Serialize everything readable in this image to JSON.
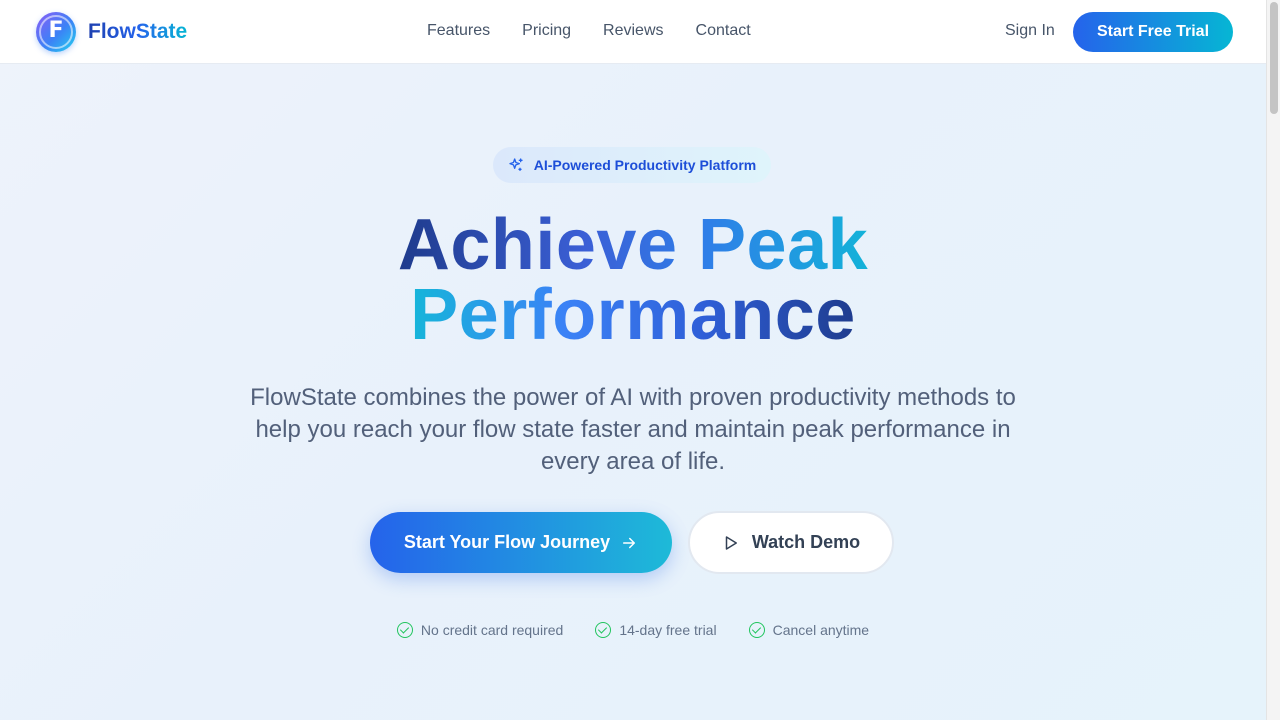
{
  "header": {
    "brand": "FlowState",
    "logo_letter": "F",
    "nav": [
      "Features",
      "Pricing",
      "Reviews",
      "Contact"
    ],
    "sign_in": "Sign In",
    "cta": "Start Free Trial"
  },
  "hero": {
    "badge_icon": "sparkles-icon",
    "badge": "AI-Powered Productivity Platform",
    "headline_line1": "Achieve Peak",
    "headline_line2": "Performance",
    "subtitle": "FlowState combines the power of AI with proven productivity methods to help you reach your flow state faster and maintain peak performance in every area of life.",
    "primary_cta": "Start Your Flow Journey",
    "secondary_cta": "Watch Demo",
    "features": [
      "No credit card required",
      "14-day free trial",
      "Cancel anytime"
    ]
  },
  "colors": {
    "accent_start": "#2563eb",
    "accent_end": "#06b6d4",
    "check": "#22c55e"
  }
}
